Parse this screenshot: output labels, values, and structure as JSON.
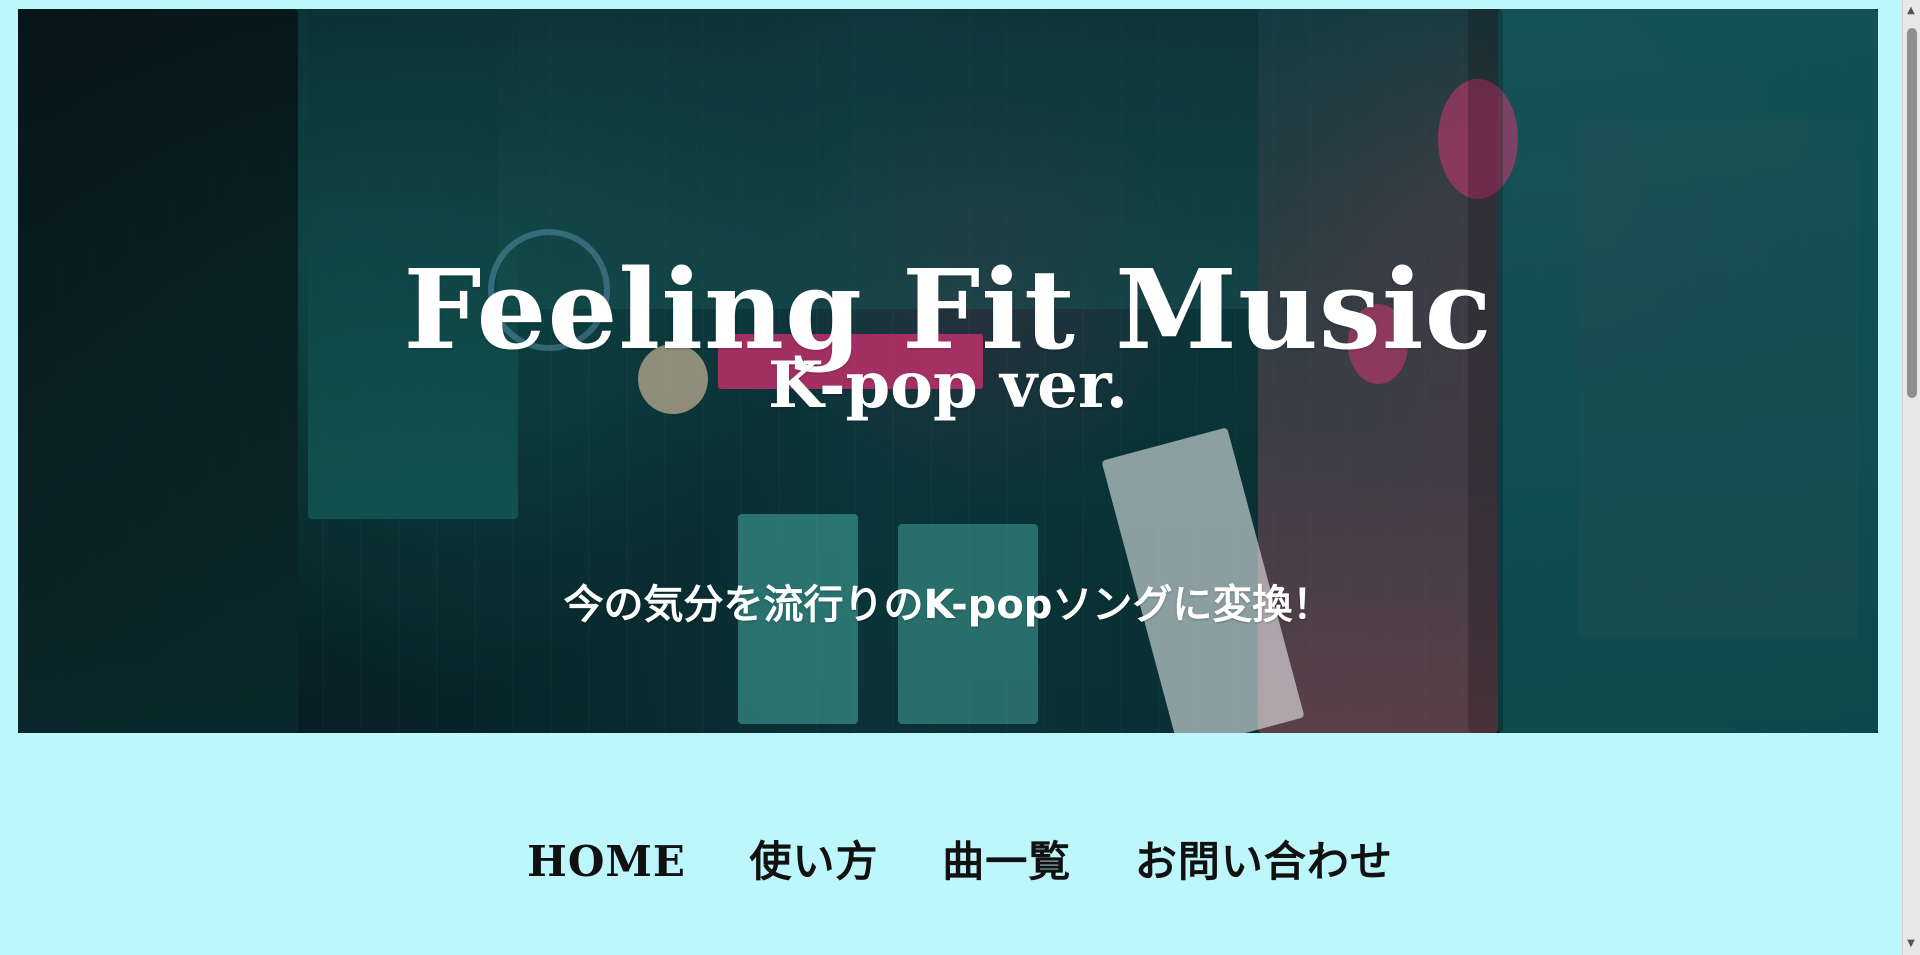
{
  "hero": {
    "title": "Feeling Fit Music",
    "subtitle": "K-pop ver.",
    "tagline": "今の気分を流行りのK-popソングに変換！"
  },
  "navigation": {
    "items": [
      {
        "label": "HOME"
      },
      {
        "label": "使い方"
      },
      {
        "label": "曲一覧"
      },
      {
        "label": "お問い合わせ"
      }
    ]
  },
  "scrollbar": {
    "up_icon": "chevron-up-icon",
    "down_icon": "chevron-down-icon"
  },
  "colors": {
    "background": "#bdf6fb",
    "hero_text": "#ffffff",
    "nav_text": "#111111"
  }
}
